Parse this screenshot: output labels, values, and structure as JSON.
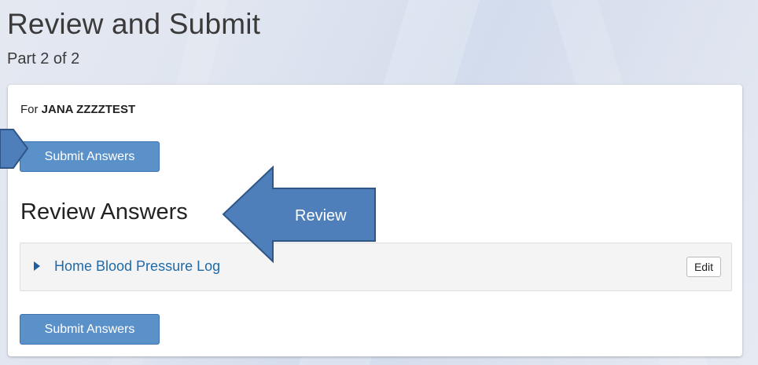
{
  "page": {
    "title": "Review and Submit",
    "subtitle": "Part 2 of 2"
  },
  "patient": {
    "prefix": "For",
    "name": "JANA ZZZZTEST"
  },
  "buttons": {
    "submit_top": "Submit Answers",
    "submit_bottom": "Submit Answers",
    "edit": "Edit"
  },
  "review": {
    "heading": "Review Answers",
    "items": [
      {
        "label": "Home Blood Pressure Log"
      }
    ]
  },
  "annotation": {
    "callout_text": "Review",
    "arrow_fill": "#4f7fba",
    "arrow_stroke": "#2e5687"
  },
  "colors": {
    "primary_button": "#5b91c9",
    "link": "#1f6aa8"
  }
}
